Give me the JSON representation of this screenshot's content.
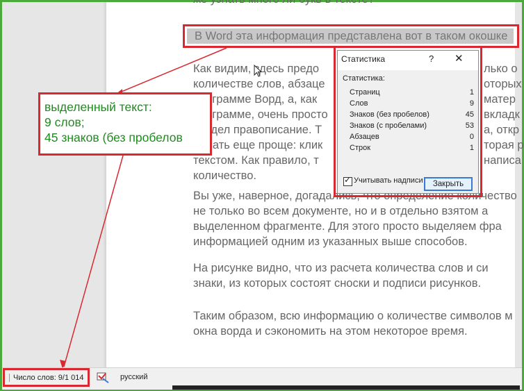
{
  "document": {
    "top_partial": "же узнать много ли букв в тексте?",
    "selected_sentence": "В Word эта информация представлена вот в таком окошке",
    "paragraph1": [
      "Как видим, здесь предо",
      "количестве слов, абзаце",
      "программе Ворд, а, как",
      "программе, очень просто",
      "раздел правописание. Т",
      "делать еще проще: клик",
      "текстом. Как правило, т",
      "количество."
    ],
    "paragraph1_right": [
      "лько о",
      "оторых",
      "матер",
      "вкладк",
      "а, откр",
      "торая р",
      "написа",
      ""
    ],
    "paragraph2": [
      "Вы уже, наверное, догадались, что определение количество",
      "не только во всем документе, но и в отдельно взятом а",
      "выделенном фрагменте. Для этого просто выделяем фра",
      "информацией одним из указанных выше способов."
    ],
    "paragraph3": [
      "На рисунке видно, что из расчета количества слов и си",
      "знаки, из которых состоят сноски и подписи рисунков."
    ],
    "paragraph4": [
      "Таким образом, всю информацию о количестве символов м",
      "окна ворда и сэкономить на этом некоторое время."
    ]
  },
  "callout": {
    "line1": "выделенный текст:",
    "line2": "9 слов;",
    "line3": "45 знаков (без пробелов"
  },
  "dialog": {
    "title": "Статистика",
    "help": "?",
    "close_glyph": "✕",
    "header": "Статистика:",
    "rows": [
      {
        "label": "Страниц",
        "value": "1"
      },
      {
        "label": "Слов",
        "value": "9"
      },
      {
        "label": "Знаков (без пробелов)",
        "value": "45"
      },
      {
        "label": "Знаков (с пробелами)",
        "value": "53"
      },
      {
        "label": "Абзацев",
        "value": "0"
      },
      {
        "label": "Строк",
        "value": "1"
      }
    ],
    "checkbox_label": "Учитывать надписи и сноски",
    "checkbox_checked": true,
    "close_button": "Закрыть"
  },
  "statusbar": {
    "word_count": "Число слов: 9/1 014",
    "language": "русский"
  },
  "colors": {
    "frame": "#4caa3c",
    "annotation": "#d9282f",
    "callout_text": "#1c8c1c"
  }
}
